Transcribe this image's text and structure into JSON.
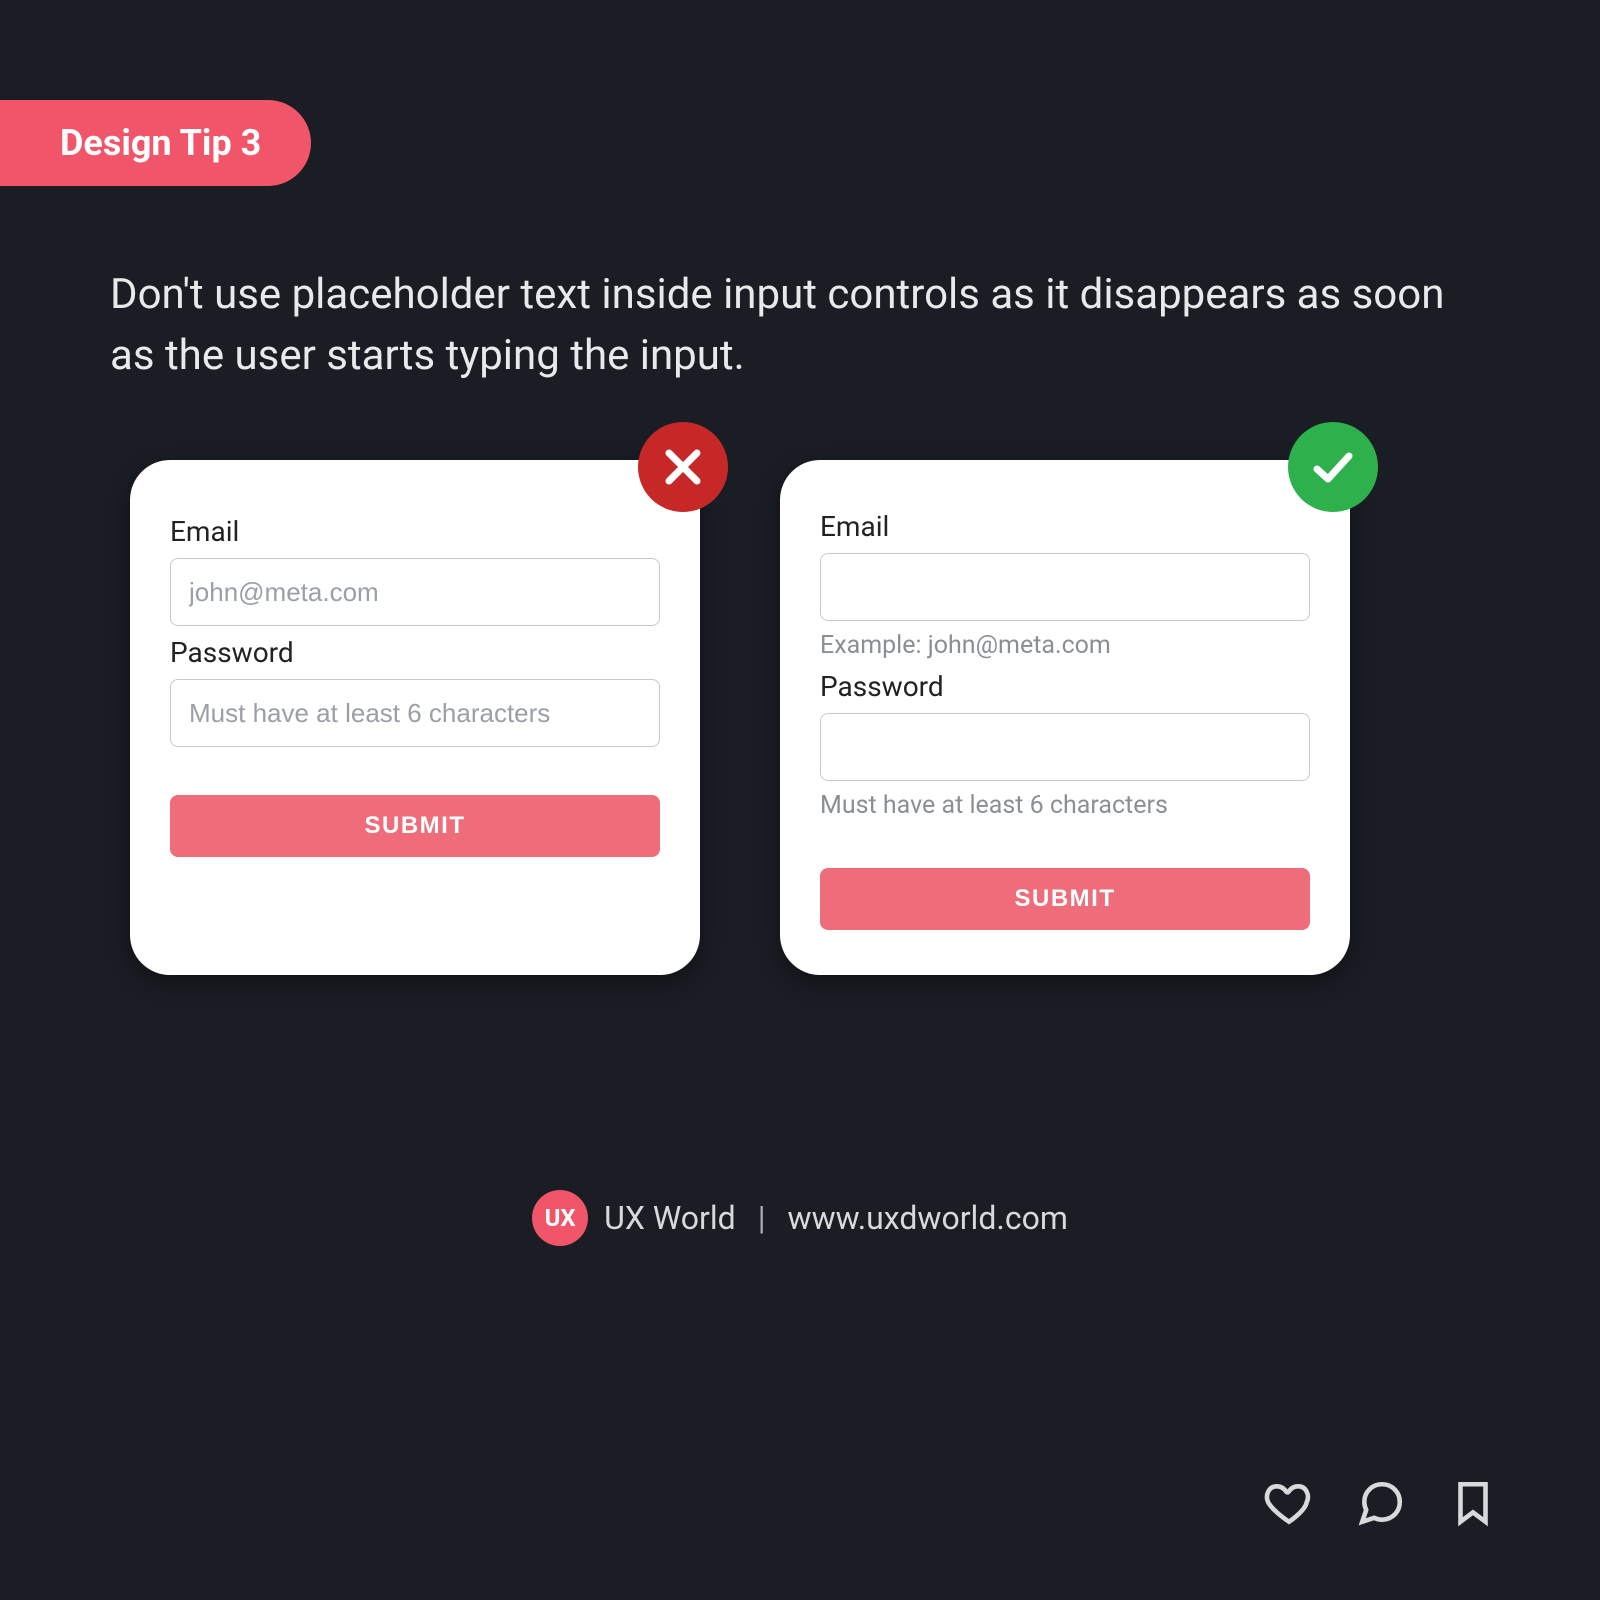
{
  "badge": {
    "label": "Design Tip 3"
  },
  "description": "Don't use placeholder text inside input controls as it disappears as soon as the user starts typing the input.",
  "cards": {
    "bad": {
      "emailLabel": "Email",
      "emailPlaceholder": "john@meta.com",
      "passwordLabel": "Password",
      "passwordPlaceholder": "Must have at least 6 characters",
      "submit": "SUBMIT"
    },
    "good": {
      "emailLabel": "Email",
      "emailHelper": "Example: john@meta.com",
      "passwordLabel": "Password",
      "passwordHelper": "Must have at least 6 characters",
      "submit": "SUBMIT"
    }
  },
  "brand": {
    "logoText": "UX",
    "name": "UX World",
    "url": "www.uxdworld.com"
  },
  "colors": {
    "accent": "#f15569",
    "submit": "#ef6d7a",
    "badBadge": "#c62828",
    "goodBadge": "#2eb14c",
    "background": "#1a1d24"
  }
}
